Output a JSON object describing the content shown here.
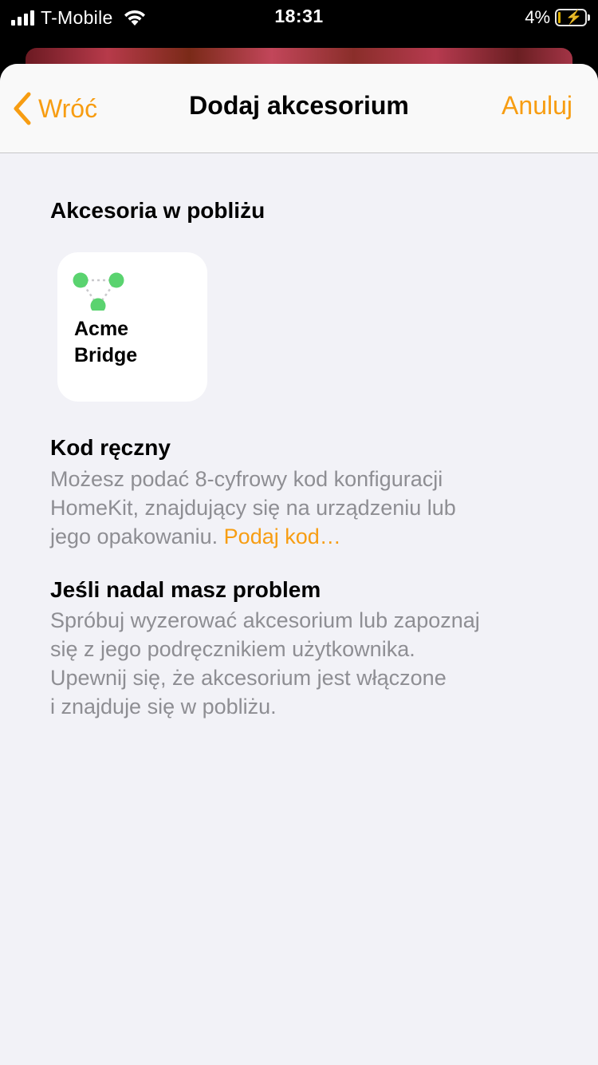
{
  "status_bar": {
    "carrier": "T-Mobile",
    "time": "18:31",
    "battery": "4%",
    "icons": [
      "signal-icon",
      "wifi-icon",
      "battery-charging-icon"
    ]
  },
  "nav": {
    "back_label": "Wróć",
    "title": "Dodaj akcesorium",
    "cancel_label": "Anuluj"
  },
  "nearby": {
    "heading": "Akcesoria w pobliżu",
    "items": [
      {
        "name_line1": "Acme",
        "name_line2": "Bridge",
        "icon": "bridge-nodes-icon"
      }
    ]
  },
  "manual_code": {
    "heading": "Kod ręczny",
    "lines": [
      "Możesz podać 8-cyfrowy kod konfiguracji",
      "HomeKit, znajdujący się na urządzeniu lub",
      "jego opakowaniu. "
    ],
    "link": "Podaj kod…"
  },
  "help": {
    "heading": "Jeśli nadal masz problem",
    "lines": [
      "Spróbuj wyzerować akcesorium lub zapoznaj",
      "się z jego podręcznikiem użytkownika.",
      "Upewnij się, że akcesorium jest włączone",
      "i znajduje się w pobliżu."
    ]
  },
  "colors": {
    "accent": "#f79d12",
    "background": "#f2f2f7",
    "secondary_text": "#8e8e93",
    "node_green": "#5ad36f"
  }
}
